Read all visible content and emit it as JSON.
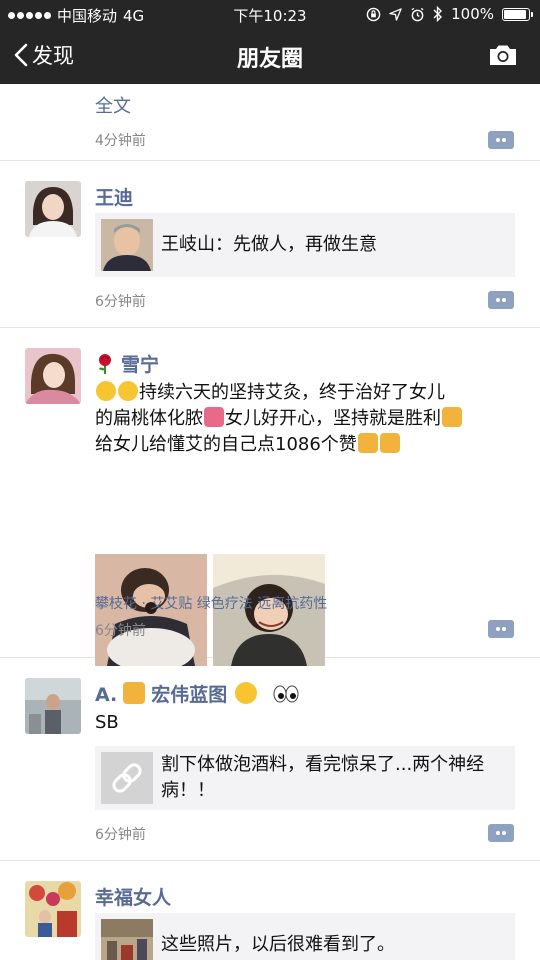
{
  "status_bar": {
    "carrier": "中国移动",
    "network": "4G",
    "time": "下午10:23",
    "battery": "100%",
    "battery_level": 1.0
  },
  "nav": {
    "back_label": "发现",
    "title": "朋友圈"
  },
  "posts": [
    {
      "full_text_label": "全文",
      "time": "4分钟前"
    },
    {
      "name": "王迪",
      "link_title": "王岐山：先做人，再做生意",
      "time": "6分钟前"
    },
    {
      "name": "雪宁",
      "text_line1": "持续六天的坚持艾灸，终于治好了女儿",
      "text_line2a": "的扁桃体化脓",
      "text_line2b": "女儿好开心，坚持就是胜利",
      "text_line3": "给女儿给懂艾的自己点1086个赞",
      "location": "攀枝花 · 艾艾贴 绿色疗法 远离抗药性",
      "time": "6分钟前"
    },
    {
      "name": "A.",
      "name2": "宏伟蓝图",
      "text": "SB",
      "link_title": "割下体做泡酒料，看完惊呆了...两个神经病！！",
      "time": "6分钟前"
    },
    {
      "name": "幸福女人",
      "link_title": "这些照片，以后很难看到了。"
    }
  ],
  "colors": {
    "nickname": "#576b95",
    "bar": "#262626",
    "link_bg": "#f3f3f5"
  }
}
